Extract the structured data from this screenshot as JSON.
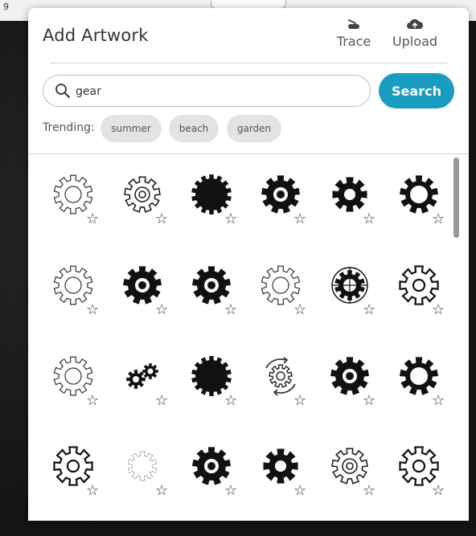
{
  "ruler": {
    "number": "9"
  },
  "panel": {
    "title": "Add Artwork",
    "trace_label": "Trace",
    "upload_label": "Upload"
  },
  "search": {
    "value": "gear",
    "button_label": "Search"
  },
  "trending": {
    "label": "Trending:",
    "chips": [
      "summer",
      "beach",
      "garden"
    ]
  },
  "icons": {
    "trace": "trace-icon",
    "upload": "cloud-upload-icon",
    "search": "magnifier-icon",
    "favorite": "star-outline-icon",
    "star_glyph": "☆"
  },
  "colors": {
    "accent": "#1a9cc1",
    "chip_bg": "#e3e3e3"
  },
  "results": [
    [
      "gear-outline-thin",
      "gear-outline-cog",
      "gear-solid-sawtooth",
      "gear-solid-ring",
      "gear-solid-chunky",
      "gear-solid-hollow"
    ],
    [
      "gear-outline-thin",
      "gear-solid-ring",
      "gear-solid-ring",
      "gear-outline-thin",
      "gear-target",
      "gear-outline-bold"
    ],
    [
      "gear-outline-thin",
      "gear-pair",
      "gear-solid-sawtooth",
      "gear-rotate-arrows",
      "gear-solid-ring",
      "gear-solid-hollow"
    ],
    [
      "gear-outline-bold",
      "gear-dotted",
      "gear-solid-ring",
      "gear-solid-chunky",
      "gear-outline-cog",
      "gear-outline-bold"
    ]
  ]
}
